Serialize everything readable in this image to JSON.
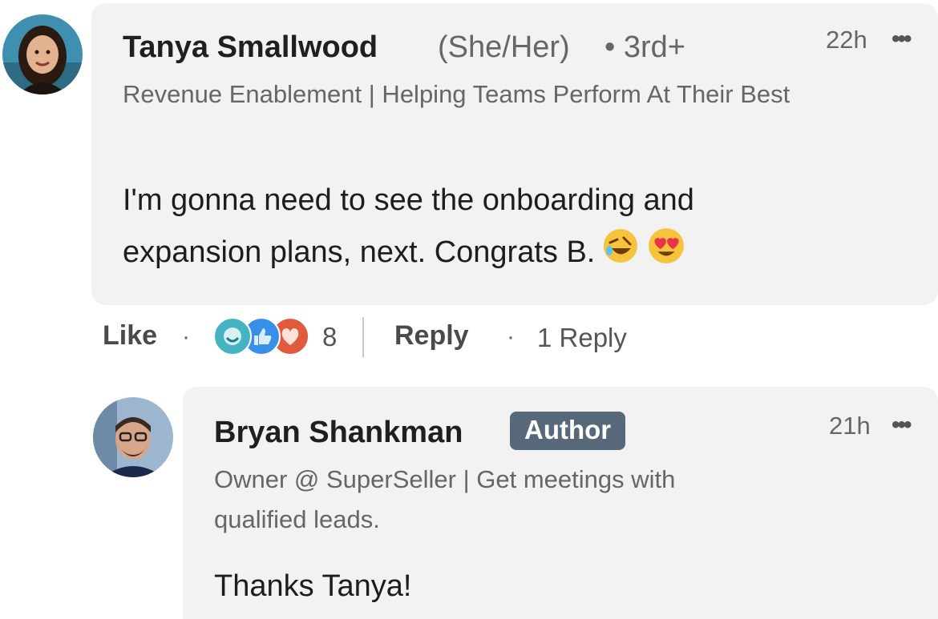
{
  "comment": {
    "author_name": "Tanya Smallwood",
    "pronouns": "(She/Her)",
    "degree": "• 3rd+",
    "headline": "Revenue Enablement | Helping Teams Perform At Their Best",
    "time": "22h",
    "more_label": "•••",
    "body": "I'm gonna need to see the onboarding and expansion plans, next. Congrats B.",
    "emojis": [
      "rolling-on-floor-laughing",
      "heart-eyes"
    ],
    "actions": {
      "like_label": "Like",
      "dot": "·",
      "reaction_icons": [
        "celebrate",
        "like",
        "love"
      ],
      "reaction_count": "8",
      "reply_label": "Reply",
      "reply_dot": "·",
      "replies_label": "1 Reply"
    }
  },
  "reply": {
    "author_name": "Bryan Shankman",
    "badge": "Author",
    "headline": "Owner @ SuperSeller | Get meetings with qualified leads.",
    "time": "21h",
    "more_label": "•••",
    "body": "Thanks Tanya!"
  },
  "colors": {
    "bubble": "#f2f2f2",
    "badge": "#56687a",
    "celebrate": "#44b3c2",
    "like": "#378fe9",
    "love": "#e05b3d"
  }
}
